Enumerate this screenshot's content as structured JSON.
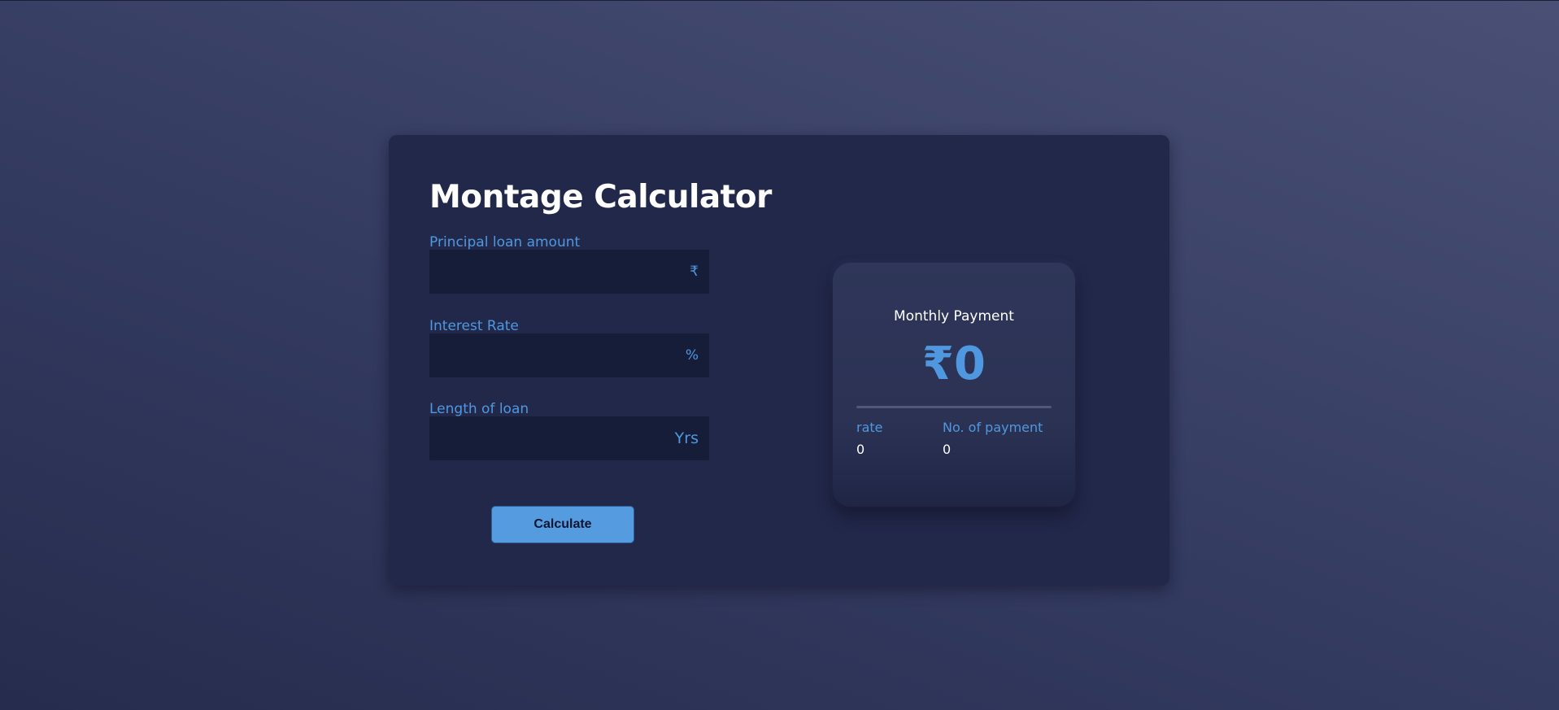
{
  "calculator": {
    "title": "Montage Calculator",
    "fields": [
      {
        "label": "Principal loan amount",
        "value": "",
        "suffix": "₹"
      },
      {
        "label": "Interest Rate",
        "value": "",
        "suffix": "%"
      },
      {
        "label": "Length of loan",
        "value": "",
        "suffix": "Yrs"
      }
    ],
    "calculate_label": "Calculate"
  },
  "result": {
    "title": "Monthly Payment",
    "amount": "₹0",
    "rate_label": "rate",
    "rate_value": "0",
    "payments_label": "No. of payment",
    "payments_value": "0"
  },
  "colors": {
    "accent": "#559be0",
    "label": "#4f98e0",
    "card": "#22284a",
    "input": "#161d38"
  }
}
